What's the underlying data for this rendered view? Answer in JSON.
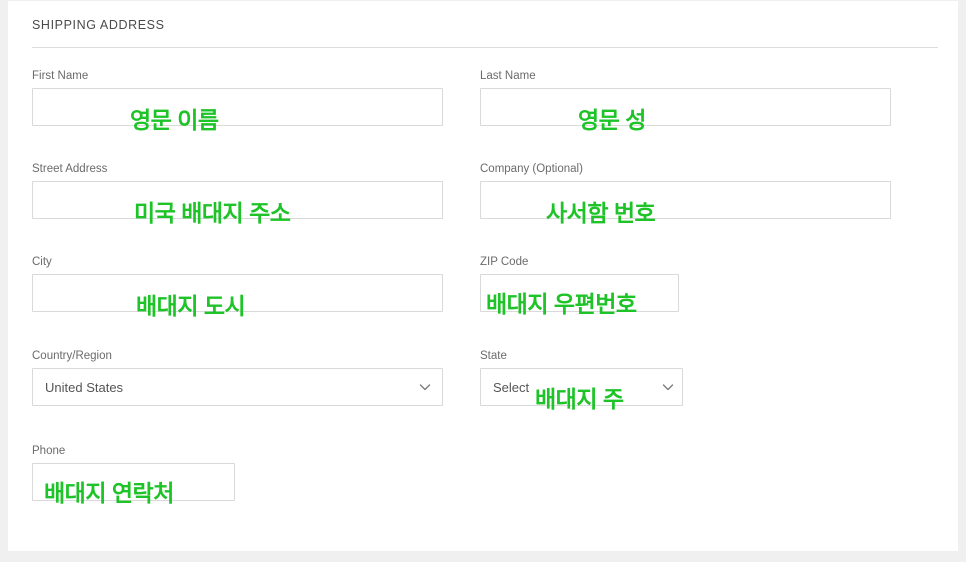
{
  "card": {
    "section_title": "SHIPPING ADDRESS"
  },
  "colors": {
    "annotation_green": "#1ec328",
    "label_gray": "#6b6b6b",
    "value_gray": "#555555",
    "border_gray": "#d9d9d9",
    "page_background": "#f0f0f0",
    "card_background": "#ffffff"
  },
  "form": {
    "fields": [
      {
        "label": "First Name",
        "value": "",
        "placeholder": "",
        "annotation": "영문 이름",
        "type": "text"
      },
      {
        "label": "Last Name",
        "value": "",
        "placeholder": "",
        "annotation": "영문 성",
        "type": "text"
      },
      {
        "label": "Street Address",
        "value": "",
        "placeholder": "",
        "annotation": "미국 배대지 주소",
        "type": "text"
      },
      {
        "label": "Company (Optional)",
        "value": "",
        "placeholder": "",
        "annotation": "사서함 번호",
        "type": "text"
      },
      {
        "label": "City",
        "value": "",
        "placeholder": "",
        "annotation": "배대지 도시",
        "type": "text"
      },
      {
        "label": "ZIP Code",
        "value": "",
        "placeholder": "",
        "annotation": "배대지 우편번호",
        "type": "text"
      },
      {
        "label": "Country/Region",
        "value": "United States",
        "placeholder": "",
        "annotation": "",
        "type": "select",
        "icon": "chevron-down-icon"
      },
      {
        "label": "State",
        "value": "Select",
        "placeholder": "Select",
        "annotation": "배대지 주",
        "type": "select",
        "icon": "chevron-down-icon"
      },
      {
        "label": "Phone",
        "value": "",
        "placeholder": "",
        "annotation": "배대지 연락처",
        "type": "text"
      }
    ]
  }
}
